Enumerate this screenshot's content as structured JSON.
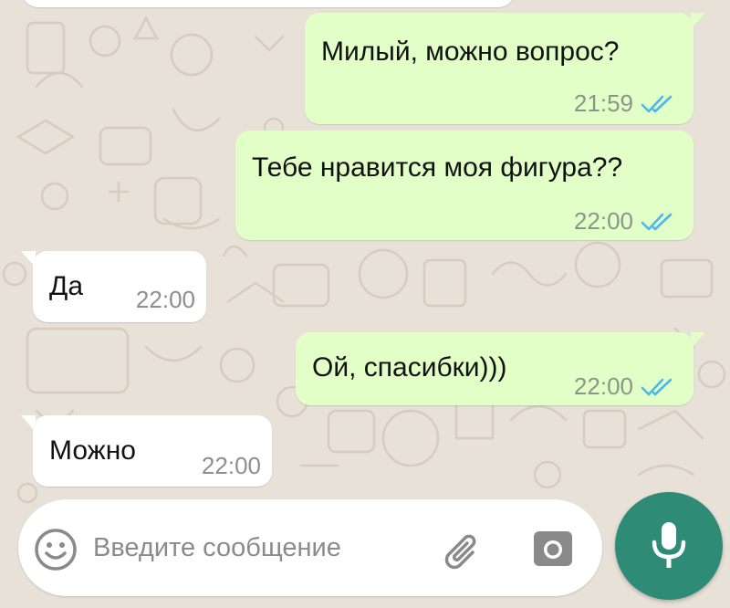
{
  "messages": [
    {
      "direction": "outgoing",
      "text": "Милый, можно вопрос?",
      "time": "21:59",
      "status": "read"
    },
    {
      "direction": "outgoing",
      "text": "Тебе нравится моя фигура??",
      "time": "22:00",
      "status": "read"
    },
    {
      "direction": "incoming",
      "text": "Да",
      "time": "22:00"
    },
    {
      "direction": "outgoing",
      "text": "Ой, спасибки)))",
      "time": "22:00",
      "status": "read"
    },
    {
      "direction": "incoming",
      "text": "Можно",
      "time": "22:00"
    }
  ],
  "composer": {
    "placeholder": "Введите сообщение",
    "value": ""
  },
  "icons": {
    "emoji": "smiley-face-icon",
    "attach": "paperclip-icon",
    "camera": "camera-icon",
    "mic": "microphone-icon",
    "read_receipt": "double-check-icon"
  },
  "colors": {
    "outgoing_bubble": "#e1ffc7",
    "incoming_bubble": "#ffffff",
    "chat_background": "#e8e1d8",
    "read_ticks": "#4fb6ec",
    "mic_button": "#2e8b76"
  }
}
